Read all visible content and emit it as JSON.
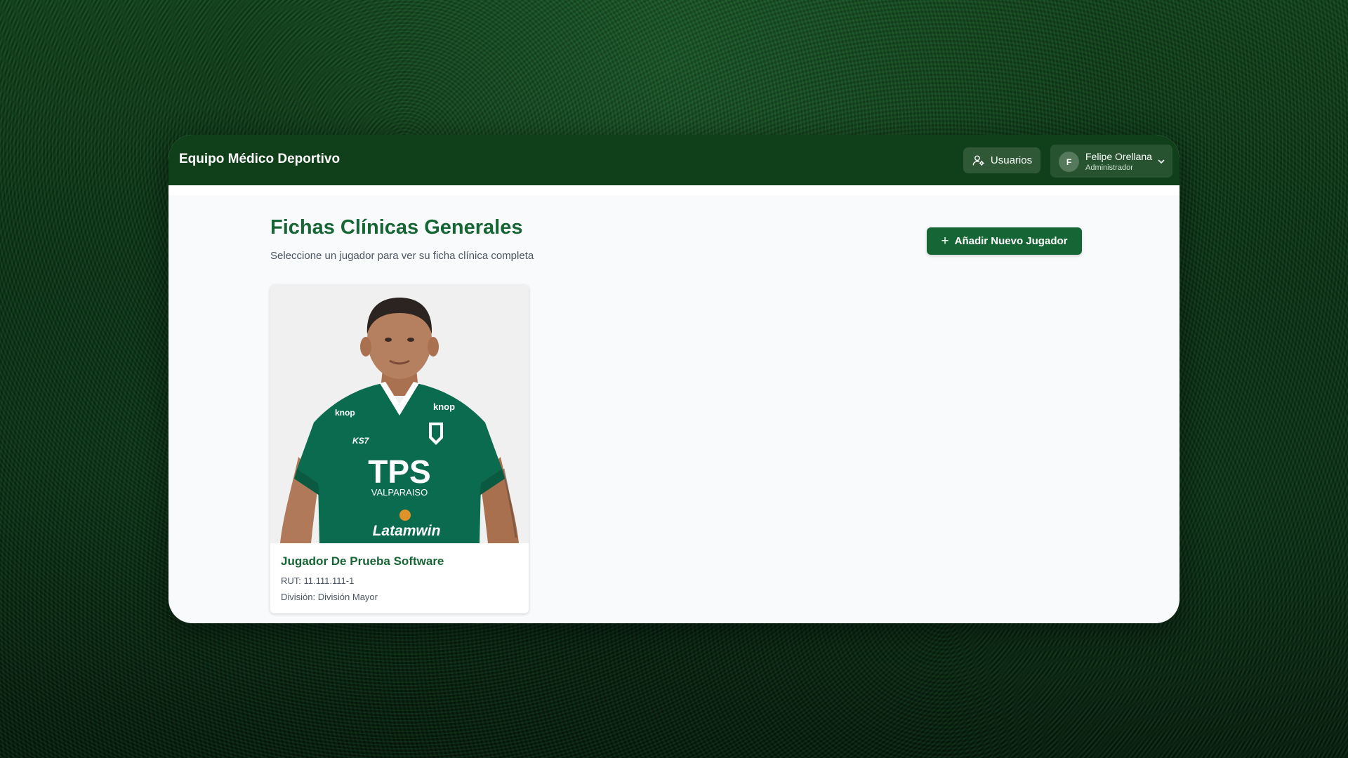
{
  "header": {
    "app_title": "Equipo Médico Deportivo",
    "users_label": "Usuarios",
    "user": {
      "initial": "F",
      "name": "Felipe Orellana",
      "role": "Administrador"
    }
  },
  "main": {
    "title": "Fichas Clínicas Generales",
    "subtitle": "Seleccione un jugador para ver su ficha clínica completa",
    "add_button_label": "Añadir Nuevo Jugador"
  },
  "players": [
    {
      "name": "Jugador De Prueba Software",
      "rut": "RUT: 11.111.111-1",
      "division": "División: División Mayor",
      "jersey": {
        "sponsor": "TPS",
        "city": "VALPARAISO",
        "second_sponsor": "Latamwin",
        "brand": "KS7",
        "patch": "knop"
      }
    }
  ],
  "colors": {
    "header_bg": "#0f4019",
    "accent": "#166534",
    "page_bg": "#f8fafc",
    "jersey": "#0b6b4e"
  },
  "icons": {
    "users": "user-settings-icon",
    "add": "plus-icon",
    "menu": "chevron-down-icon"
  }
}
